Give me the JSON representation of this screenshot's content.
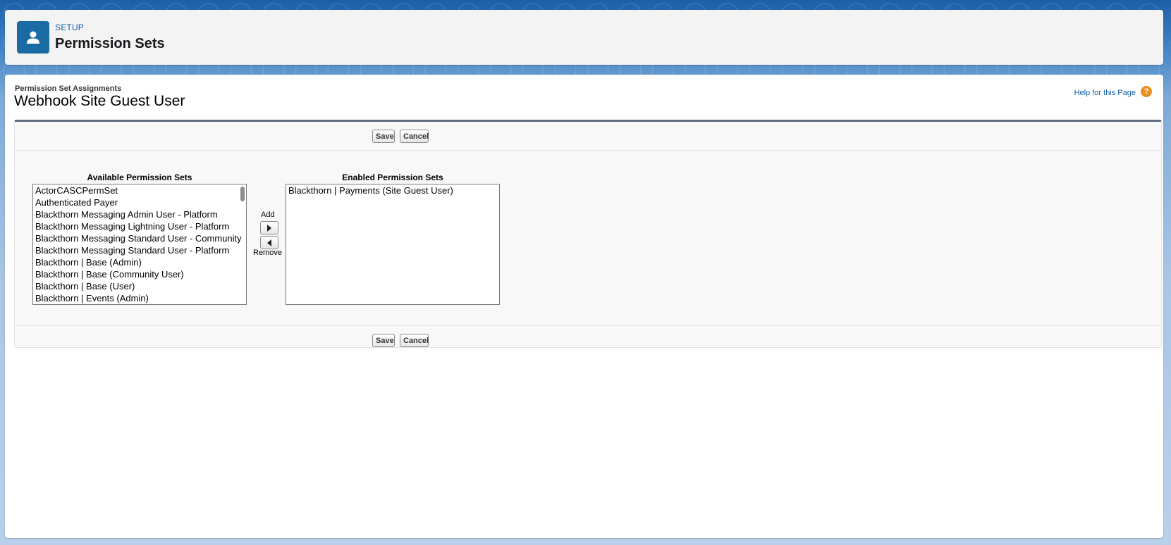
{
  "header": {
    "icon": "user-icon",
    "setup_label": "SETUP",
    "title": "Permission Sets"
  },
  "page": {
    "section_label": "Permission Set Assignments",
    "user_name": "Webhook Site Guest User",
    "help_link": "Help for this Page",
    "help_icon": "?"
  },
  "buttons": {
    "save": "Save",
    "cancel": "Cancel"
  },
  "available": {
    "title": "Available Permission Sets",
    "items": [
      "ActorCASCPermSet",
      "Authenticated Payer",
      "Blackthorn Messaging Admin User - Platform",
      "Blackthorn Messaging Lightning User - Platform",
      "Blackthorn Messaging Standard User - Community",
      "Blackthorn Messaging Standard User - Platform",
      "Blackthorn | Base (Admin)",
      "Blackthorn | Base (Community User)",
      "Blackthorn | Base (User)",
      "Blackthorn | Events (Admin)"
    ]
  },
  "enabled": {
    "title": "Enabled Permission Sets",
    "items": [
      "Blackthorn | Payments (Site Guest User)"
    ]
  },
  "move": {
    "add_label": "Add",
    "remove_label": "Remove"
  },
  "colors": {
    "header_icon_bg": "#1a6aa3",
    "link": "#0e5fa8",
    "help_icon": "#e99021",
    "block_top_border": "#5e6c7e"
  }
}
